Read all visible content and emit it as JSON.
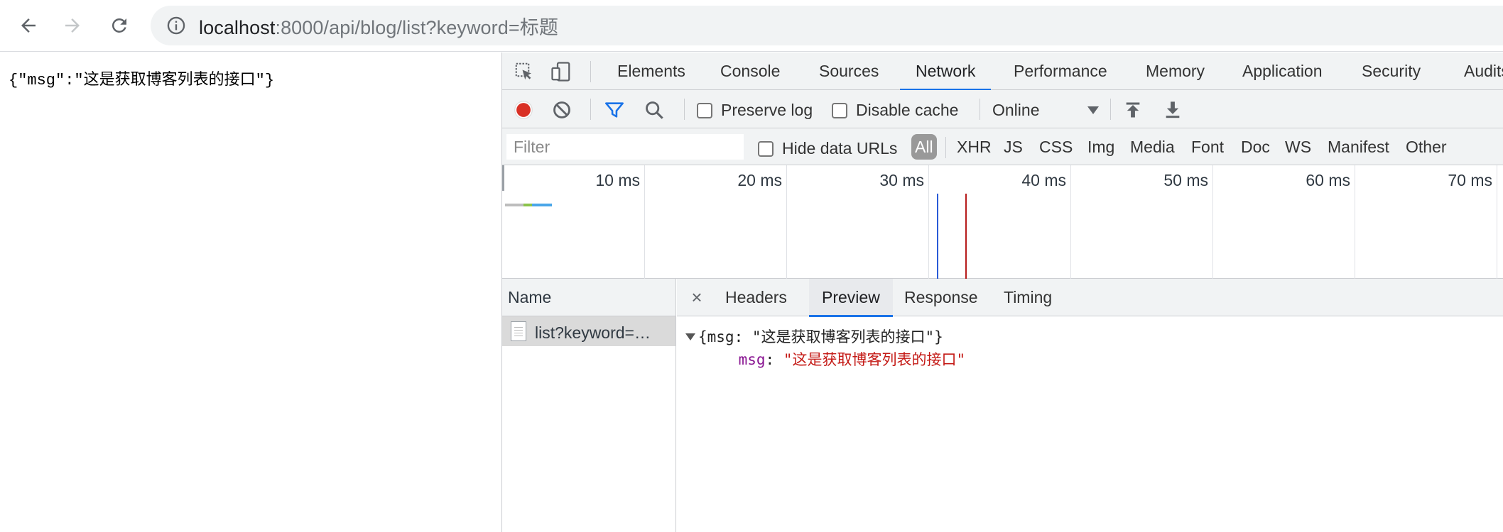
{
  "browser": {
    "url_host": "localhost",
    "url_path": ":8000/api/blog/list?keyword=标题"
  },
  "page": {
    "raw_json": "{\"msg\":\"这是获取博客列表的接口\"}"
  },
  "devtools": {
    "tabs": [
      "Elements",
      "Console",
      "Sources",
      "Network",
      "Performance",
      "Memory",
      "Application",
      "Security",
      "Audits"
    ],
    "active_tab": "Network",
    "network_bar": {
      "preserve_log": "Preserve log",
      "disable_cache": "Disable cache",
      "throttle": "Online"
    },
    "filter": {
      "placeholder": "Filter",
      "hide_data_urls": "Hide data URLs",
      "types": [
        "All",
        "XHR",
        "JS",
        "CSS",
        "Img",
        "Media",
        "Font",
        "Doc",
        "WS",
        "Manifest",
        "Other"
      ],
      "active_type": "All"
    },
    "timeline": {
      "ticks": [
        "10 ms",
        "20 ms",
        "30 ms",
        "40 ms",
        "50 ms",
        "60 ms",
        "70 ms"
      ],
      "dom_content_loaded_ms": 30.6,
      "load_ms": 32.6,
      "blue_line_color": "#2a5bd7",
      "red_line_color": "#b71c1c"
    },
    "name_column": {
      "header": "Name",
      "rows": [
        "list?keyword=标题"
      ]
    },
    "detail": {
      "close": "×",
      "tabs": [
        "Headers",
        "Preview",
        "Response",
        "Timing"
      ],
      "active_tab": "Preview",
      "preview_summary": "{msg: \"这是获取博客列表的接口\"}",
      "preview_key": "msg",
      "preview_value": "\"这是获取博客列表的接口\""
    }
  }
}
